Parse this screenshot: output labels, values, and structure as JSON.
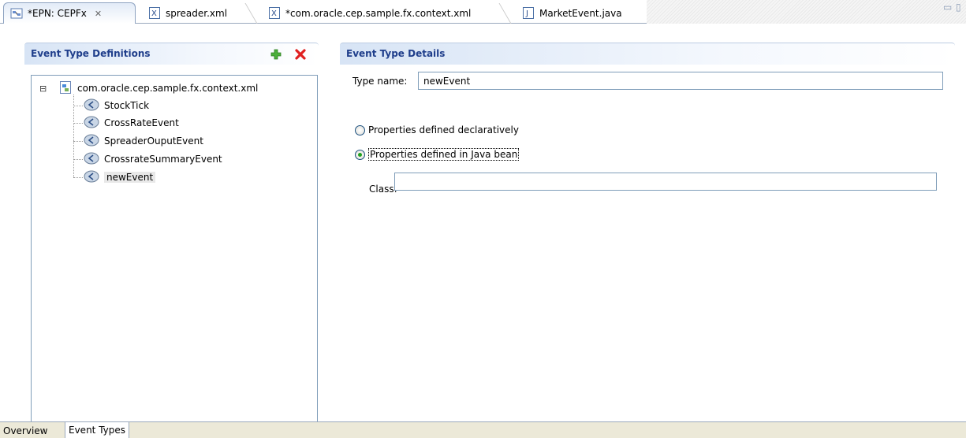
{
  "tabs": [
    {
      "label": "*EPN: CEPFx",
      "close": "✕"
    },
    {
      "label": "spreader.xml"
    },
    {
      "label": "*com.oracle.cep.sample.fx.context.xml"
    },
    {
      "label": "MarketEvent.java"
    }
  ],
  "left": {
    "title": "Event Type Definitions",
    "add_icon": "plus-icon",
    "delete_icon": "delete-icon",
    "tree": {
      "root": "com.oracle.cep.sample.fx.context.xml",
      "root_toggle": "⊟",
      "items": [
        "StockTick",
        "CrossRateEvent",
        "SpreaderOuputEvent",
        "CrossrateSummaryEvent",
        "newEvent"
      ],
      "selected": "newEvent"
    }
  },
  "right": {
    "title": "Event Type Details",
    "type_name_label": "Type name:",
    "type_name_value": "newEvent",
    "radio_declarative": "Properties defined declaratively",
    "radio_java": "Properties defined in Java bean",
    "selected_option": "java",
    "class_label": "Class:",
    "class_value": ""
  },
  "bottom_tabs": [
    "Overview",
    "Event Types"
  ],
  "active_bottom_tab": "Event Types",
  "colors": {
    "accent": "#1f3e8b",
    "border": "#7f9db9",
    "section_gradient": "#d7e4f5"
  }
}
